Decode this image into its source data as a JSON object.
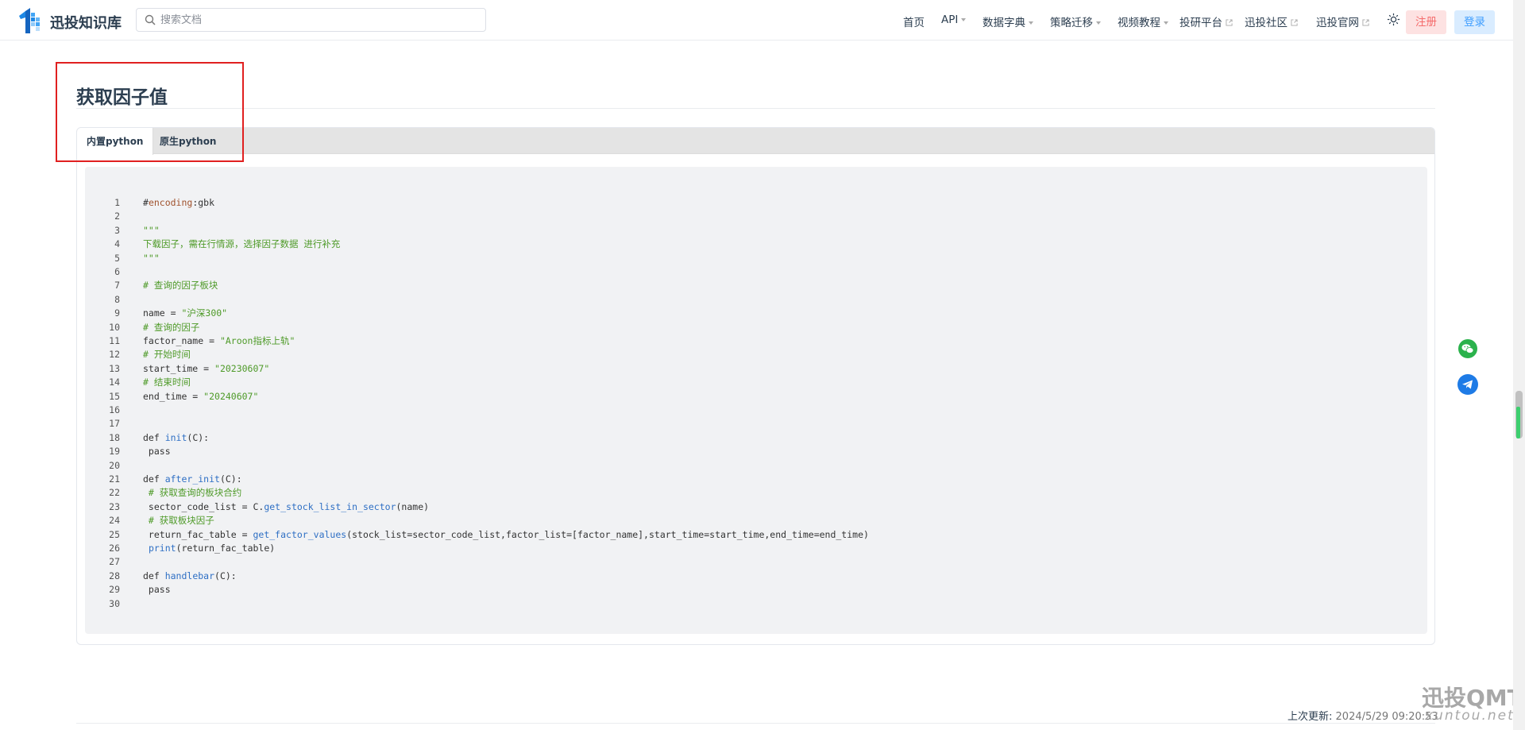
{
  "header": {
    "site_name": "迅投知识库",
    "search_placeholder": "搜索文档",
    "nav": [
      {
        "label": "首页"
      },
      {
        "label": "API"
      },
      {
        "label": "数据字典"
      },
      {
        "label": "策略迁移"
      },
      {
        "label": "视频教程"
      },
      {
        "label": "投研平台"
      },
      {
        "label": "迅投社区"
      },
      {
        "label": "迅投官网"
      }
    ],
    "register_label": "注册",
    "login_label": "登录"
  },
  "page": {
    "title": "获取因子值",
    "tabs": [
      {
        "label": "内置python",
        "active": true
      },
      {
        "label": "原生python",
        "active": false
      }
    ]
  },
  "code": {
    "lines": [
      {
        "n": "1",
        "t": "#encoding:gbk"
      },
      {
        "n": "2",
        "t": ""
      },
      {
        "n": "3",
        "t": "\"\"\""
      },
      {
        "n": "4",
        "t": "下载因子，需在行情源，选择因子数据 进行补充"
      },
      {
        "n": "5",
        "t": "\"\"\""
      },
      {
        "n": "6",
        "t": ""
      },
      {
        "n": "7",
        "t": "# 查询的因子板块"
      },
      {
        "n": "8",
        "t": ""
      },
      {
        "n": "9",
        "t": "name = \"沪深300\""
      },
      {
        "n": "10",
        "t": "# 查询的因子"
      },
      {
        "n": "11",
        "t": "factor_name = \"Aroon指标上轨\""
      },
      {
        "n": "12",
        "t": "# 开始时间"
      },
      {
        "n": "13",
        "t": "start_time = \"20230607\""
      },
      {
        "n": "14",
        "t": "# 结束时间"
      },
      {
        "n": "15",
        "t": "end_time = \"20240607\""
      },
      {
        "n": "16",
        "t": ""
      },
      {
        "n": "17",
        "t": ""
      },
      {
        "n": "18",
        "t": "def init(C):"
      },
      {
        "n": "19",
        "t": " pass"
      },
      {
        "n": "20",
        "t": ""
      },
      {
        "n": "21",
        "t": "def after_init(C):"
      },
      {
        "n": "22",
        "t": " # 获取查询的板块合约"
      },
      {
        "n": "23",
        "t": " sector_code_list = C.get_stock_list_in_sector(name)"
      },
      {
        "n": "24",
        "t": " # 获取板块因子"
      },
      {
        "n": "25",
        "t": " return_fac_table = get_factor_values(stock_list=sector_code_list,factor_list=[factor_name],start_time=start_time,end_time=end_time)"
      },
      {
        "n": "26",
        "t": " print(return_fac_table)"
      },
      {
        "n": "27",
        "t": ""
      },
      {
        "n": "28",
        "t": "def handlebar(C):"
      },
      {
        "n": "29",
        "t": " pass"
      },
      {
        "n": "30",
        "t": ""
      }
    ]
  },
  "footer": {
    "last_update_label": "上次更新:",
    "last_update_value": "2024/5/29 09:20:53"
  },
  "watermark": {
    "main": "迅投QMT",
    "sub": "xuntou.net"
  },
  "colors": {
    "accent": "#409eff",
    "register": "#f56c6c",
    "highlight": "#e02020"
  }
}
